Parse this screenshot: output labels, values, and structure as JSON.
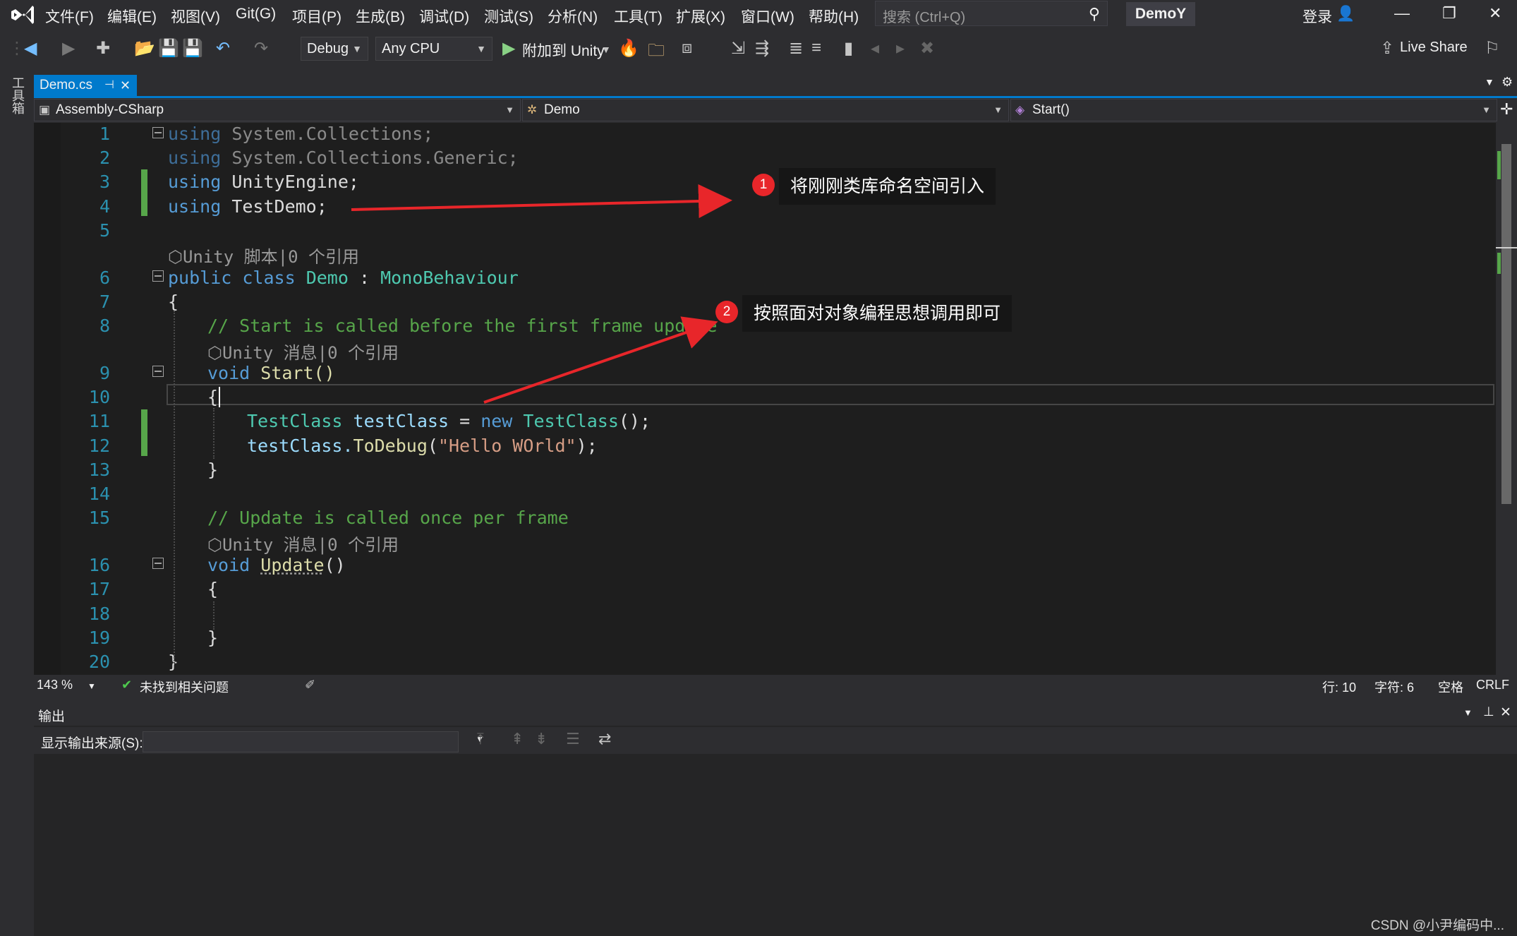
{
  "menu": [
    "文件(F)",
    "编辑(E)",
    "视图(V)",
    "Git(G)",
    "项目(P)",
    "生成(B)",
    "调试(D)",
    "测试(S)",
    "分析(N)",
    "工具(T)",
    "扩展(X)",
    "窗口(W)",
    "帮助(H)"
  ],
  "search": {
    "placeholder": "搜索 (Ctrl+Q)"
  },
  "solution_name": "DemoY",
  "account": {
    "login": "登录"
  },
  "toolbar": {
    "config": "Debug",
    "platform": "Any CPU",
    "attach": "附加到 Unity",
    "live_share": "Live Share"
  },
  "side_strip": {
    "label": "工具箱"
  },
  "tab": {
    "label": "Demo.cs"
  },
  "navbar": {
    "project": "Assembly-CSharp",
    "class": "Demo",
    "member": "Start()"
  },
  "code": {
    "line_numbers": [
      "1",
      "2",
      "3",
      "4",
      "5",
      "6",
      "7",
      "8",
      "9",
      "10",
      "11",
      "12",
      "13",
      "14",
      "15",
      "16",
      "17",
      "18",
      "19",
      "20"
    ],
    "lens_unity_script": "Unity 脚本|0 个引用",
    "lens_unity_message": "Unity 消息|0 个引用",
    "using_kw": "using",
    "ns1": "System.Collections;",
    "ns2": "System.Collections.Generic;",
    "ns3": "UnityEngine;",
    "ns4": "TestDemo;",
    "l6_public": "public",
    "l6_class": "class",
    "l6_name": "Demo",
    "l6_colon": ":",
    "l6_base": "MonoBehaviour",
    "brace_open": "{",
    "brace_close": "}",
    "comment_start": "// Start is called before the first frame update",
    "void_kw": "void",
    "start_sig": "Start()",
    "l11_type": "TestClass",
    "l11_var": "testClass",
    "l11_eq": "=",
    "l11_new": "new",
    "l11_ctor": "TestClass",
    "l11_end": "();",
    "l12_obj": "testClass.",
    "l12_fn": "ToDebug",
    "l12_paren": "(",
    "l12_str": "\"Hello WOrld\"",
    "l12_end": ");",
    "comment_update": "// Update is called once per frame",
    "update_name": "Update",
    "update_paren": "()"
  },
  "annotations": [
    {
      "number": "1",
      "text": "将刚刚类库命名空间引入"
    },
    {
      "number": "2",
      "text": "按照面对对象编程思想调用即可"
    }
  ],
  "editor_status": {
    "zoom": "143 %",
    "issues": "未找到相关问题",
    "line": "行: 10",
    "char": "字符: 6",
    "spaces": "空格",
    "eol": "CRLF"
  },
  "output": {
    "title": "输出",
    "source_label": "显示输出来源(S):"
  },
  "watermark": "CSDN @小尹编码中...",
  "colors": {
    "accent": "#007acc",
    "annotation_red": "#e8262a",
    "editor_bg": "#1e1e1e"
  }
}
